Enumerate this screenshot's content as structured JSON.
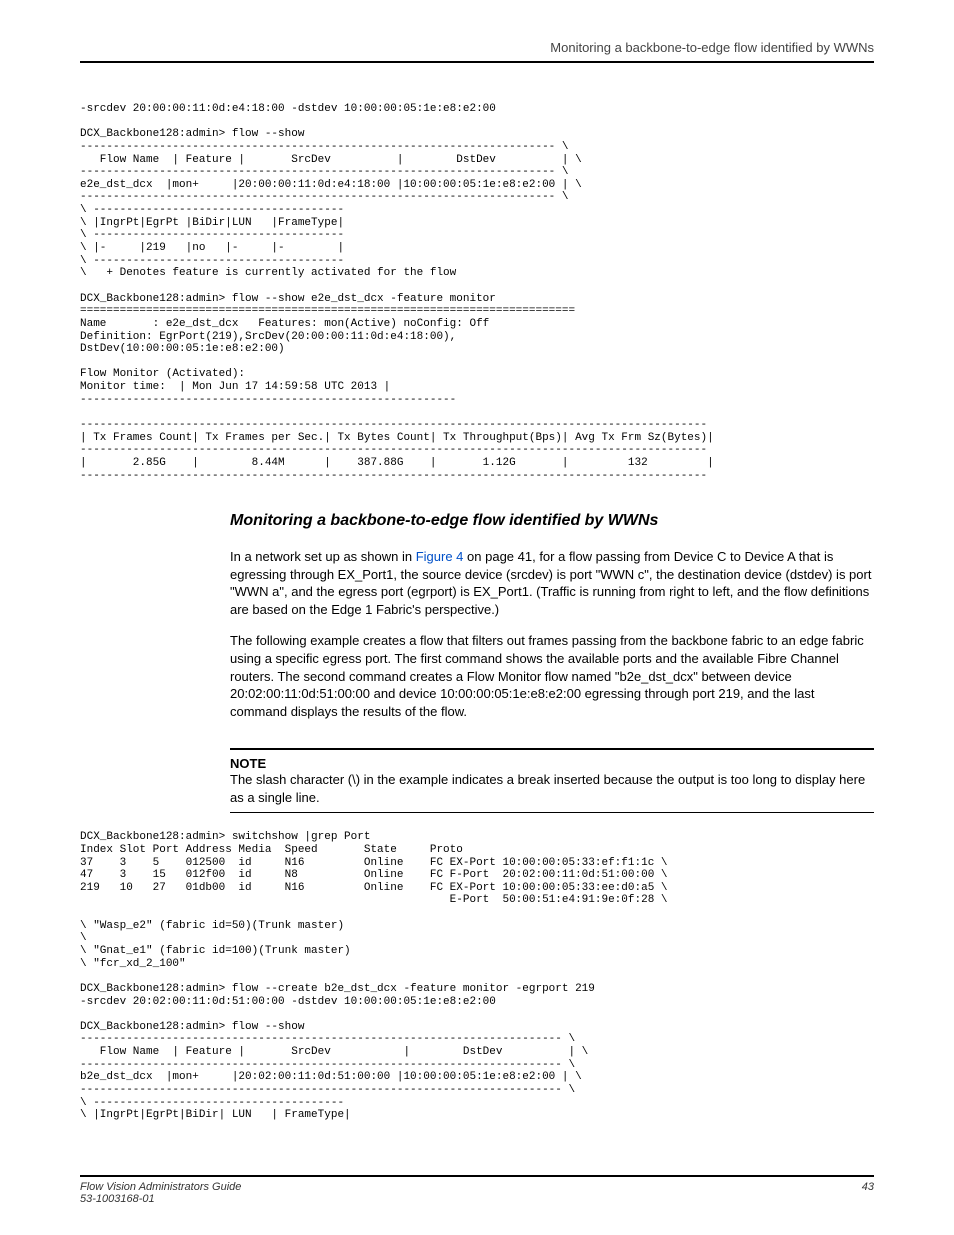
{
  "header": {
    "running": "Monitoring a backbone-to-edge flow identified by WWNs"
  },
  "code1": "-srcdev 20:00:00:11:0d:e4:18:00 -dstdev 10:00:00:05:1e:e8:e2:00\n\nDCX_Backbone128:admin> flow --show\n------------------------------------------------------------------------ \\\n   Flow Name  | Feature |       SrcDev          |        DstDev          | \\\n------------------------------------------------------------------------ \\\ne2e_dst_dcx  |mon+     |20:00:00:11:0d:e4:18:00 |10:00:00:05:1e:e8:e2:00 | \\\n------------------------------------------------------------------------ \\\n\\ --------------------------------------\n\\ |IngrPt|EgrPt |BiDir|LUN   |FrameType|\n\\ --------------------------------------\n\\ |-     |219   |no   |-     |-        |\n\\ --------------------------------------\n\\   + Denotes feature is currently activated for the flow\n\nDCX_Backbone128:admin> flow --show e2e_dst_dcx -feature monitor\n===========================================================================\nName       : e2e_dst_dcx   Features: mon(Active) noConfig: Off\nDefinition: EgrPort(219),SrcDev(20:00:00:11:0d:e4:18:00),\nDstDev(10:00:00:05:1e:e8:e2:00)\n\nFlow Monitor (Activated):\nMonitor time:  | Mon Jun 17 14:59:58 UTC 2013 |\n---------------------------------------------------------\n\n-----------------------------------------------------------------------------------------------\n| Tx Frames Count| Tx Frames per Sec.| Tx Bytes Count| Tx Throughput(Bps)| Avg Tx Frm Sz(Bytes)|\n-----------------------------------------------------------------------------------------------\n|       2.85G    |        8.44M      |    387.88G    |       1.12G       |         132         |\n-----------------------------------------------------------------------------------------------",
  "section": {
    "title": "Monitoring a backbone-to-edge flow identified by WWNs",
    "para1a": "In a network set up as shown in ",
    "para1link": "Figure 4",
    "para1b": " on page 41, for a flow passing from Device C to Device A that is egressing through EX_Port1, the source device (srcdev) is port \"WWN c\", the destination device (dstdev) is port \"WWN a\", and the egress port (egrport) is EX_Port1. (Traffic is running from right to left, and the flow definitions are based on the Edge 1 Fabric's perspective.)",
    "para2": "The following example creates a flow that filters out frames passing from the backbone fabric to an edge fabric using a specific egress port. The first command shows the available ports and the available Fibre Channel routers. The second command creates a Flow Monitor flow named \"b2e_dst_dcx\" between device 20:02:00:11:0d:51:00:00 and device 10:00:00:05:1e:e8:e2:00 egressing through port 219, and the last command displays the results of the flow."
  },
  "note": {
    "label": "NOTE",
    "body": "The slash character (\\) in the example indicates a break inserted because the output is too long to display here as a single line."
  },
  "code2": "DCX_Backbone128:admin> switchshow |grep Port\nIndex Slot Port Address Media  Speed       State     Proto\n37    3    5    012500  id     N16         Online    FC EX-Port 10:00:00:05:33:ef:f1:1c \\\n47    3    15   012f00  id     N8          Online    FC F-Port  20:02:00:11:0d:51:00:00 \\\n219   10   27   01db00  id     N16         Online    FC EX-Port 10:00:00:05:33:ee:d0:a5 \\\n                                                        E-Port  50:00:51:e4:91:9e:0f:28 \\\n\n\\ \"Wasp_e2\" (fabric id=50)(Trunk master)\n\\ \n\\ \"Gnat_e1\" (fabric id=100)(Trunk master)\n\\ \"fcr_xd_2_100\"\n\nDCX_Backbone128:admin> flow --create b2e_dst_dcx -feature monitor -egrport 219\n-srcdev 20:02:00:11:0d:51:00:00 -dstdev 10:00:00:05:1e:e8:e2:00\n\nDCX_Backbone128:admin> flow --show\n------------------------------------------------------------------------- \\\n   Flow Name  | Feature |       SrcDev           |        DstDev          | \\\n------------------------------------------------------------------------- \\\nb2e_dst_dcx  |mon+     |20:02:00:11:0d:51:00:00 |10:00:00:05:1e:e8:e2:00 | \\\n------------------------------------------------------------------------- \\\n\\ --------------------------------------\n\\ |IngrPt|EgrPt|BiDir| LUN   | FrameType|",
  "footer": {
    "left1": "Flow Vision Administrators Guide",
    "left2": "53-1003168-01",
    "page": "43"
  }
}
